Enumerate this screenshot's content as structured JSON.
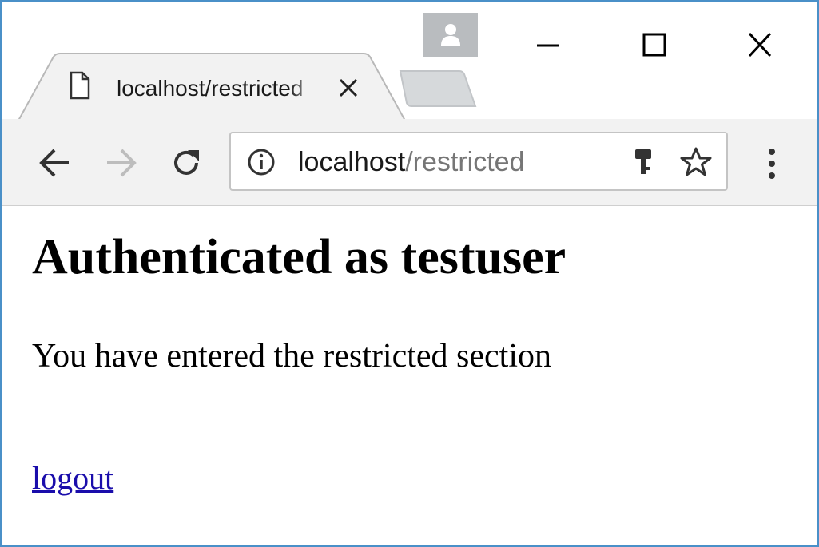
{
  "window": {
    "title_bar": {
      "profile_icon": "person-icon",
      "controls": [
        "minimize-icon",
        "maximize-icon",
        "close-icon"
      ]
    }
  },
  "tab": {
    "title": "localhost/restricted",
    "icon": "document-icon",
    "close_icon": "close-icon"
  },
  "toolbar": {
    "back_icon": "arrow-left-icon",
    "forward_icon": "arrow-right-icon",
    "reload_icon": "reload-icon",
    "menu_icon": "more-vertical-icon",
    "address": {
      "host": "localhost",
      "path": "/restricted",
      "info_icon": "info-icon",
      "key_icon": "key-icon",
      "star_icon": "star-icon"
    }
  },
  "page": {
    "heading": "Authenticated as testuser",
    "message": "You have entered the restricted section",
    "logout_link": "logout"
  },
  "colors": {
    "window_border": "#4a90c8",
    "link": "#1a0dab",
    "toolbar_bg": "#f2f2f2",
    "url_path": "#767676"
  }
}
